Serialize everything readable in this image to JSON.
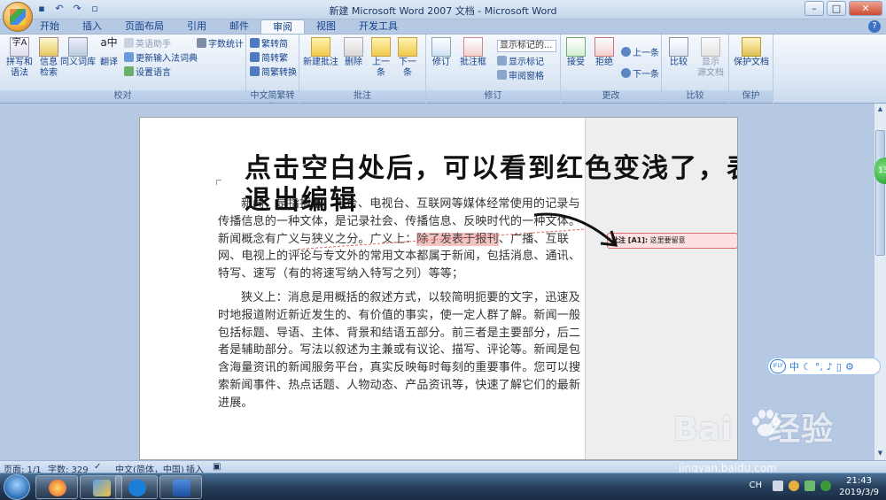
{
  "window": {
    "title": "新建 Microsoft Word 2007 文档 - Microsoft Word",
    "controls": [
      "minimize",
      "maximize",
      "close"
    ]
  },
  "quick_access": [
    "save-icon",
    "undo-icon",
    "redo-icon",
    "print-preview-icon"
  ],
  "tabs": [
    {
      "label": "开始",
      "active": false
    },
    {
      "label": "插入",
      "active": false
    },
    {
      "label": "页面布局",
      "active": false
    },
    {
      "label": "引用",
      "active": false
    },
    {
      "label": "邮件",
      "active": false
    },
    {
      "label": "审阅",
      "active": true
    },
    {
      "label": "视图",
      "active": false
    },
    {
      "label": "开发工具",
      "active": false
    }
  ],
  "ribbon": {
    "proofing": {
      "label": "校对",
      "spelling": "拼写和\n语法",
      "research": "信息\n检索",
      "thesaurus": "同义词库",
      "translate": "翻译",
      "translate_tip": "英语助手",
      "update_ime": "更新输入法词典",
      "set_language": "设置语言",
      "word_count": "字数统计"
    },
    "chinese": {
      "label": "中文简繁转换",
      "to_traditional": "繁转简",
      "to_simplified": "简转繁",
      "convert": "简繁转换"
    },
    "comments": {
      "label": "批注",
      "new": "新建批注",
      "delete": "删除",
      "previous": "上一\n条",
      "next": "下一\n条"
    },
    "tracking": {
      "label": "修订",
      "track": "修订",
      "balloons": "批注框",
      "display_for_review": "显示标记的...",
      "show_markup": "显示标记",
      "reviewing_pane": "审阅窗格"
    },
    "changes": {
      "label": "更改",
      "accept": "接受",
      "reject": "拒绝",
      "previous": "上一条",
      "next": "下一条"
    },
    "compare": {
      "label": "比较",
      "compare": "比较",
      "show_source": "显示\n源文档"
    },
    "protect": {
      "label": "保护",
      "protect_document": "保护文档"
    }
  },
  "document": {
    "para1_pre": "新闻，是指报纸、电台、电视台、互联网等媒体经常使用的记录与传播信息的一种文体，是记录社会、传播信息、反映时代的一种文体。新闻概念有广义与狭义之分。广义上：",
    "para1_highlight": "除了发表于报刊",
    "para1_post": "、广播、互联网、电视上的评论与专文外的常用文本都属于新闻，包括消息、通讯、特写、速写（有的将速写纳入特写之列）等等；",
    "para2": "狭义上：消息是用概括的叙述方式，以较简明扼要的文字，迅速及时地报道附近新近发生的、有价值的事实，使一定人群了解。新闻一般包括标题、导语、主体、背景和结语五部分。前三者是主要部分，后二者是辅助部分。写法以叙述为主兼或有议论、描写、评论等。新闻是包含海量资讯的新闻服务平台，真实反映每时每刻的重要事件。您可以搜索新闻事件、热点话题、人物动态、产品资讯等，快速了解它们的最新进展。",
    "comment_label": "批注 [A1]:",
    "comment_text": "这里要留意",
    "annotation": "点击空白处后，可以看到红色变浅了，表示已经退出编辑"
  },
  "statusbar": {
    "page": "页面: 1/1",
    "words": "字数: 329",
    "language": "中文(简体，中国)",
    "mode": "插入"
  },
  "ime": {
    "logo": "iFLY",
    "mode": "中"
  },
  "tray": {
    "lang": "CH",
    "time": "21:43",
    "date": "2019/3/9"
  },
  "watermark": {
    "brand": "Bai",
    "brand2": "经验",
    "url": "jingyan.baidu.com"
  },
  "colors": {
    "highlight": "#f5c2c2",
    "comment_border": "#e2696b",
    "ribbon_text": "#15428b"
  }
}
